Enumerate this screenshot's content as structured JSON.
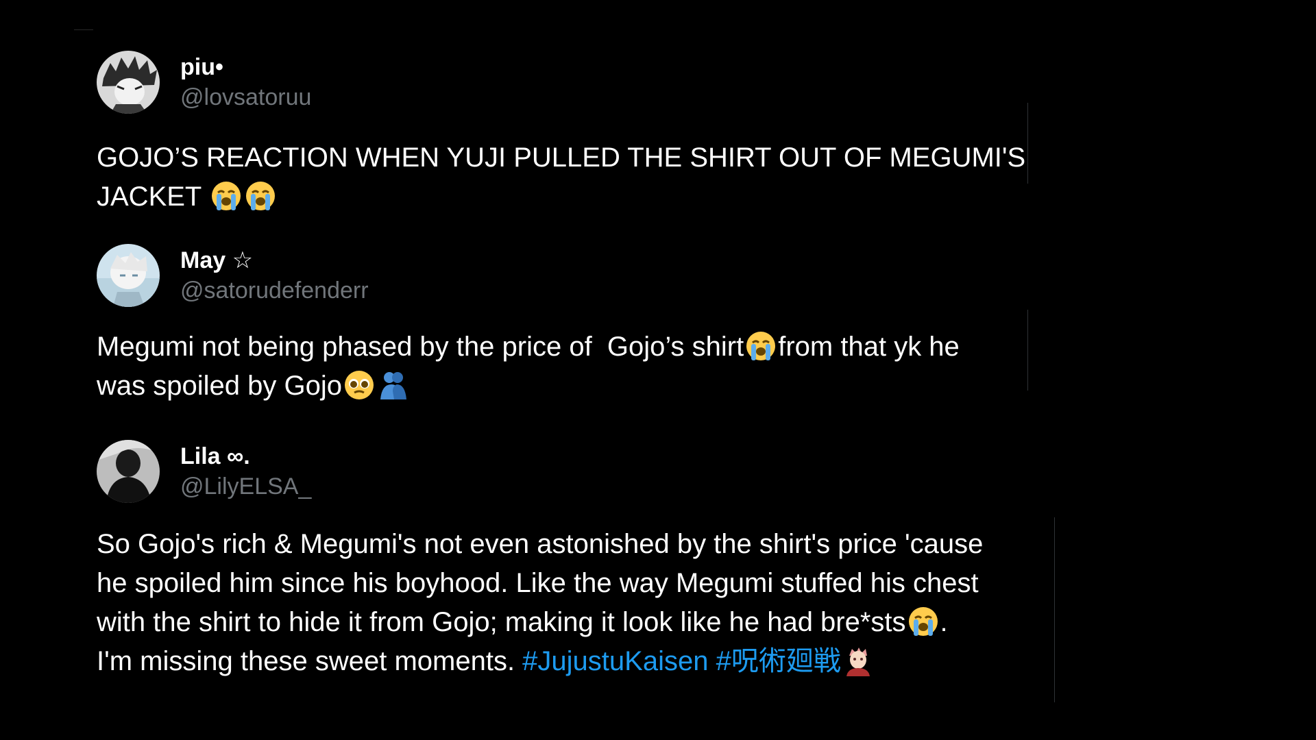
{
  "tweets": [
    {
      "display_name": "piu•",
      "handle": "@lovsatoruu",
      "text_line1": "GOJO’S REACTION WHEN YUJI PULLED THE SHIRT OUT OF MEGUMI'S",
      "text_line2": "JACKET ",
      "emojis": [
        "loudly-crying-face-emoji",
        "loudly-crying-face-emoji"
      ]
    },
    {
      "display_name": "May ☆",
      "handle": "@satorudefenderr",
      "text_part1": "Megumi not being phased by the price of  Gojo’s shirt",
      "text_part2": "from that yk he",
      "text_part3": "was spoiled by Gojo",
      "emojis": [
        "loudly-crying-face-emoji",
        "pleading-face-emoji",
        "people-hugging-emoji"
      ]
    },
    {
      "display_name": "Lila ∞.",
      "handle": "@LilyELSA_",
      "text_line1": "So Gojo's rich & Megumi's not even astonished by the shirt's price 'cause",
      "text_line2": "he spoiled him since his boyhood. Like the way Megumi stuffed his chest",
      "text_line3a": "with the shirt to hide it from Gojo; making it look like he had bre*sts",
      "text_line3b": ".",
      "text_line4": "I'm missing these sweet moments. ",
      "hashtag1": "#JujustuKaisen",
      "hashtag2": "#呪術廻戦",
      "emojis": [
        "loudly-crying-face-emoji",
        "character-face-emoji"
      ]
    }
  ],
  "colors": {
    "background": "#000000",
    "text": "#ffffff",
    "handle": "#71767b",
    "hashtag": "#1d9bf0"
  }
}
